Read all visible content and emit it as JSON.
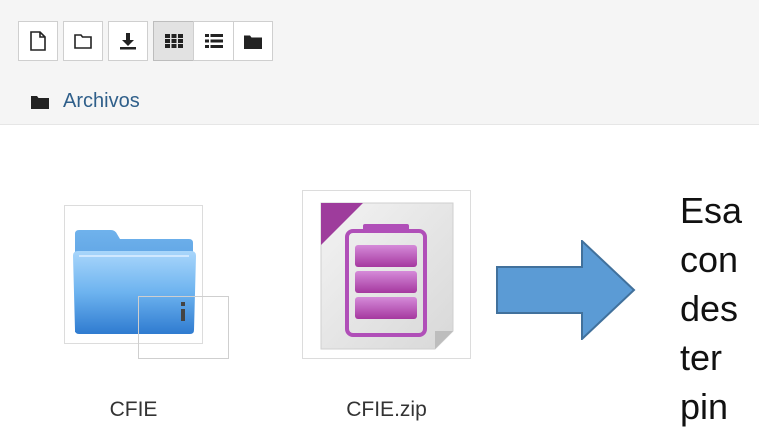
{
  "toolbar": {
    "buttons": [
      {
        "icon": "new-file-icon"
      },
      {
        "icon": "new-folder-icon"
      },
      {
        "icon": "download-icon"
      },
      {
        "icon": "grid-view-icon",
        "active": true
      },
      {
        "icon": "list-view-icon",
        "active": false
      },
      {
        "icon": "tree-view-icon",
        "active": false
      }
    ]
  },
  "breadcrumb": {
    "icon": "folder-icon",
    "label": "Archivos"
  },
  "files": [
    {
      "name": "CFIE",
      "icon": "folder-icon"
    },
    {
      "name": "CFIE.zip",
      "icon": "zip-archive-icon"
    }
  ],
  "annotation": {
    "arrow_color": "#5b9bd5",
    "lines": [
      "Esa",
      "con",
      "des",
      "ter",
      "pin"
    ]
  },
  "colors": {
    "link": "#2f5f8a",
    "toolbar_bg": "#f5f5f5",
    "folder_blue": "#4a90d9",
    "zip_purple": "#b04fb8"
  }
}
